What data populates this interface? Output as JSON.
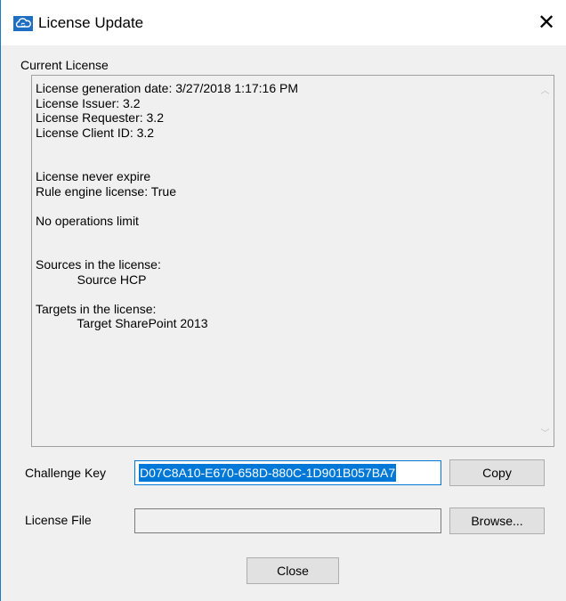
{
  "window": {
    "title": "License Update",
    "close_glyph": "✕",
    "icon": "cloud-sync-icon"
  },
  "current_license": {
    "label": "Current License",
    "lines": [
      "License generation date: 3/27/2018 1:17:16 PM",
      "License Issuer: 3.2",
      "License Requester: 3.2",
      "License Client ID: 3.2",
      "",
      "",
      "License never expire",
      "Rule engine license: True",
      "",
      "No operations limit",
      "",
      "",
      "Sources in the license:",
      "            Source HCP",
      "",
      "Targets in the license:",
      "            Target SharePoint 2013"
    ]
  },
  "challenge": {
    "label": "Challenge Key",
    "value": "D07C8A10-E670-658D-880C-1D901B057BA7",
    "copy_label": "Copy"
  },
  "license_file": {
    "label": "License File",
    "value": "",
    "browse_label": "Browse..."
  },
  "footer": {
    "close_label": "Close"
  }
}
